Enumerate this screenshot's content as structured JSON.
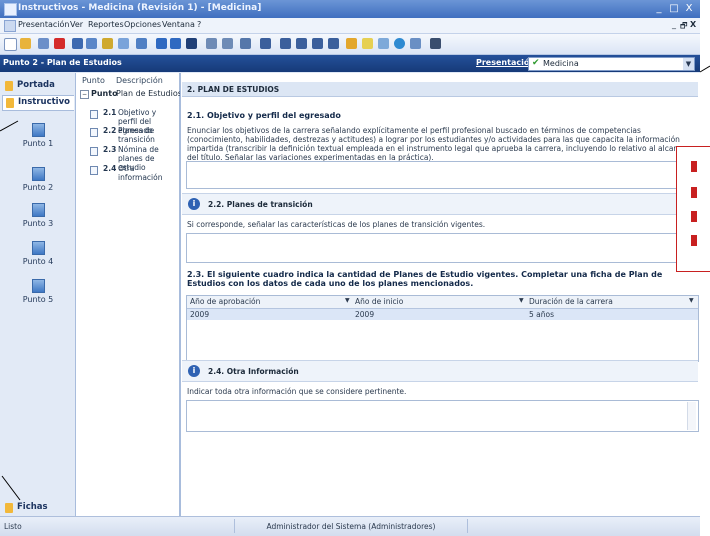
{
  "window": {
    "title": "Instructivos - Medicina (Revisión 1) - [Medicina]",
    "controls": [
      "_",
      "□",
      "X"
    ],
    "doc_controls": [
      "_",
      "🗗",
      "X"
    ]
  },
  "menu": {
    "items": [
      "Presentación",
      "Ver",
      "Reportes",
      "Opciones",
      "Ventana",
      "?"
    ]
  },
  "panel": {
    "title": "Punto 2 - Plan de Estudios",
    "presentation_label": "Presentación:",
    "presentation_value": "Medicina"
  },
  "nav": {
    "portada": "Portada",
    "instructivo": "Instructivo",
    "points": [
      "Punto 1",
      "Punto 2",
      "Punto 3",
      "Punto 4",
      "Punto 5"
    ],
    "fichas": "Fichas"
  },
  "tree": {
    "col_punto": "Punto",
    "col_desc": "Descripción",
    "root_num": "Punto",
    "root_desc": "Plan de Estudios",
    "items": [
      {
        "num": "2.1",
        "desc": "Objetivo y perfil del egresado"
      },
      {
        "num": "2.2",
        "desc": "Planes de transición"
      },
      {
        "num": "2.3",
        "desc": "Nómina de planes de estudio"
      },
      {
        "num": "2.4",
        "desc": "Otra información"
      }
    ]
  },
  "content": {
    "section_title": "2. PLAN DE ESTUDIOS",
    "s21_title": "2.1. Objetivo y perfil del egresado",
    "s21_text": "Enunciar los objetivos de la carrera señalando explícitamente el perfil profesional buscado en términos de competencias (conocimiento, habilidades, destrezas y actitudes) a lograr por los estudiantes y/o actividades para las que capacita la información impartida (transcribir la definición textual empleada en el instrumento legal que aprueba la carrera, incluyendo lo relativo al alcance del título. Señalar las variaciones experimentadas en la práctica).",
    "s22_title": "2.2. Planes de transición",
    "s22_text": "Si corresponde, señalar las características de los planes de transición vigentes.",
    "s23_title": "2.3. El siguiente cuadro indica la cantidad de Planes de Estudio vigentes. Completar una ficha de Plan de Estudios con los datos de cada uno de los planes mencionados.",
    "grid_headers": [
      "Año de aprobación",
      "Año de inicio",
      "Duración de la carrera"
    ],
    "grid_rows": [
      [
        "2009",
        "2009",
        "5 años"
      ]
    ],
    "s24_title": "2.4. Otra Información",
    "s24_text": "Indicar toda otra información que se considere pertinente."
  },
  "status": {
    "left": "Listo",
    "center": "Administrador del Sistema (Administradores)"
  },
  "icons": {
    "info": "info-icon",
    "doc": "document-icon",
    "folder": "folder-icon"
  },
  "colors": {
    "title_bar": "#3f6fbf",
    "panel_header": "#1c4489",
    "callout": "#c82020"
  }
}
